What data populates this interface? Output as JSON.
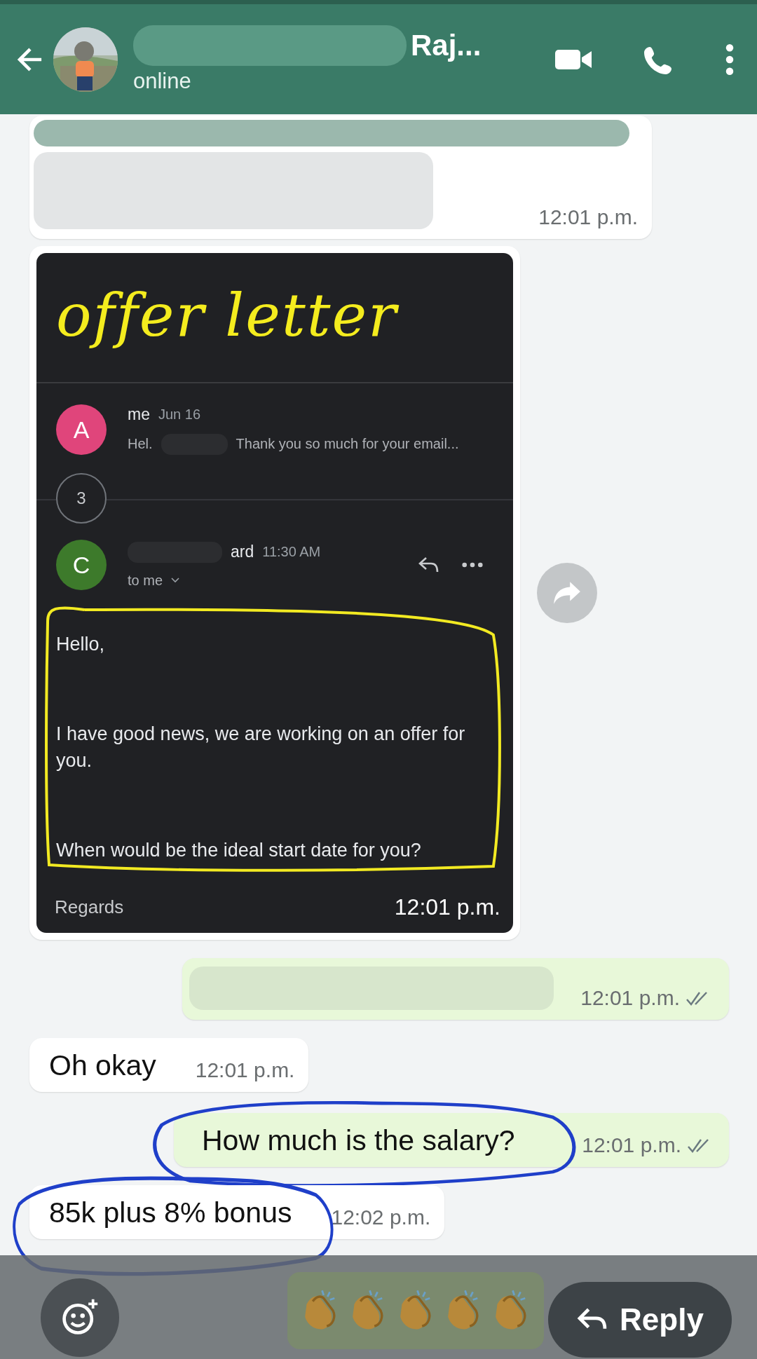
{
  "header": {
    "name": "Raj...",
    "status": "online"
  },
  "messages": [
    {
      "kind": "redacted_in",
      "time": "12:01 p.m."
    },
    {
      "time": "12:01 p.m.",
      "screenshot": {
        "annotation": "offer letter",
        "threads": [
          {
            "avatar": "A",
            "color": "#e0457b",
            "sender": "me",
            "date": "Jun 16",
            "snippet_start": "Hel.",
            "snippet": "Thank you so much for your email..."
          }
        ],
        "count": "3",
        "open": {
          "avatar": "C",
          "color": "#3d7a2b",
          "sender": "ard",
          "time": "11:30 AM",
          "recipient": "to me",
          "body": [
            "Hello,",
            "I have good news, we are working on an offer for you.",
            "When would be the ideal start date for you?"
          ],
          "signoff": "Regards"
        }
      }
    },
    {
      "kind": "redacted_out",
      "time": "12:01 p.m.",
      "read": true
    },
    {
      "kind": "text_in",
      "text": "Oh okay",
      "time": "12:01 p.m.",
      "circled": false
    },
    {
      "kind": "text_out",
      "text": "How much is the salary?",
      "time": "12:01 p.m.",
      "read": true,
      "circled": true
    },
    {
      "kind": "text_in",
      "text": "85k plus 8% bonus",
      "time": "12:02 p.m.",
      "circled": true
    }
  ],
  "footer": {
    "reply_label": "Reply"
  }
}
